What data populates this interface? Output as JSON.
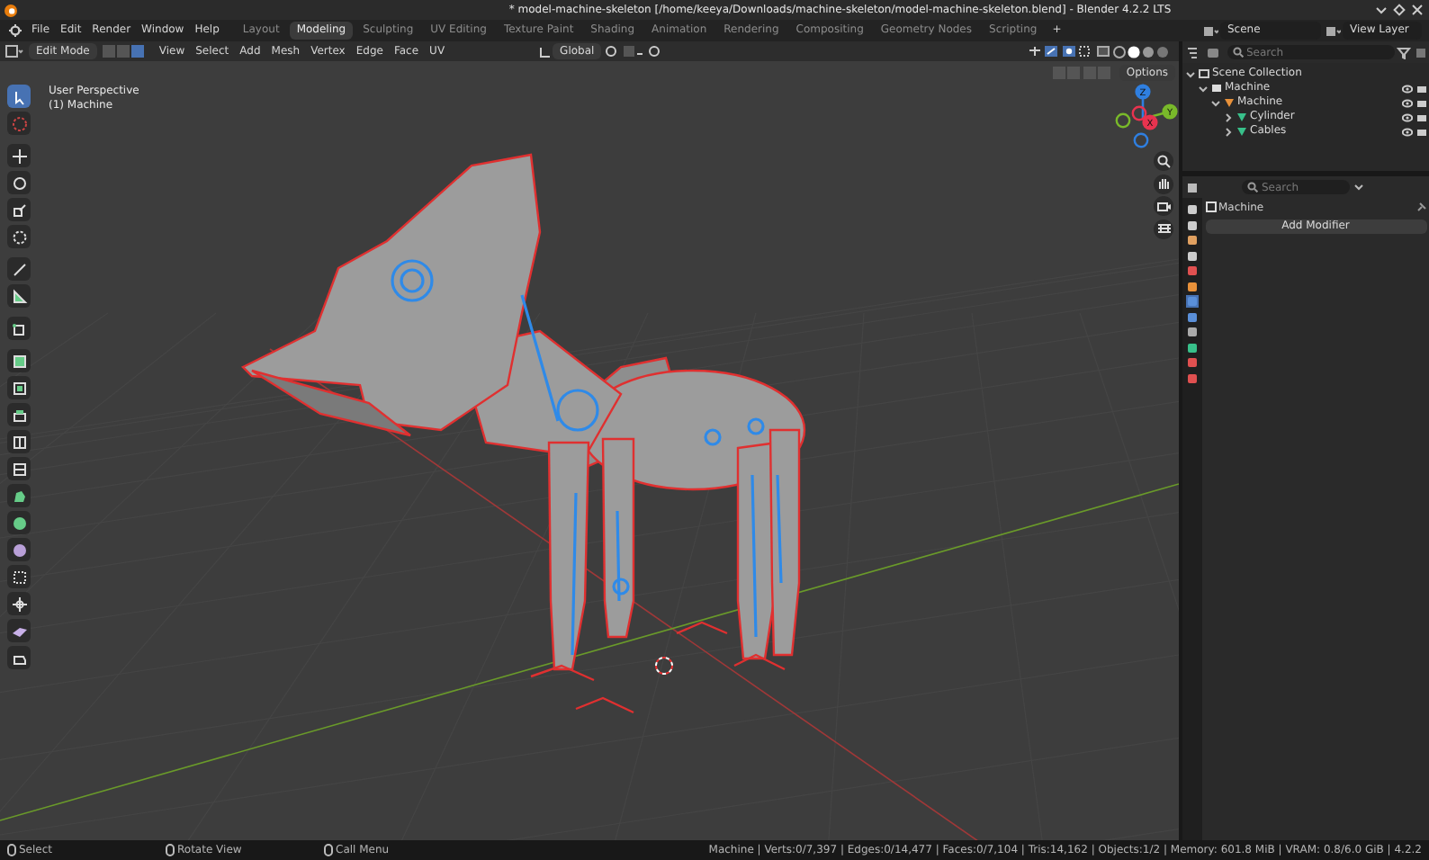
{
  "window": {
    "title": "* model-machine-skeleton [/home/keeya/Downloads/machine-skeleton/model-machine-skeleton.blend] - Blender 4.2.2 LTS"
  },
  "menu": [
    "File",
    "Edit",
    "Render",
    "Window",
    "Help"
  ],
  "workspaces": [
    {
      "label": "Layout",
      "selected": false
    },
    {
      "label": "Modeling",
      "selected": true
    },
    {
      "label": "Sculpting",
      "selected": false
    },
    {
      "label": "UV Editing",
      "selected": false
    },
    {
      "label": "Texture Paint",
      "selected": false
    },
    {
      "label": "Shading",
      "selected": false
    },
    {
      "label": "Animation",
      "selected": false
    },
    {
      "label": "Rendering",
      "selected": false
    },
    {
      "label": "Compositing",
      "selected": false
    },
    {
      "label": "Geometry Nodes",
      "selected": false
    },
    {
      "label": "Scripting",
      "selected": false
    }
  ],
  "add_workspace": "+",
  "scene": "Scene",
  "view_layer": "View Layer",
  "viewport_header": {
    "mode": "Edit Mode",
    "select_modes": [
      {
        "selected": false
      },
      {
        "selected": false
      },
      {
        "selected": true
      }
    ],
    "menus": [
      "View",
      "Select",
      "Add",
      "Mesh",
      "Vertex",
      "Edge",
      "Face",
      "UV"
    ],
    "orientation": "Global",
    "options": "Options"
  },
  "viewport": {
    "overlay": [
      "User Perspective",
      "(1) Machine"
    ],
    "gizmo": [
      {
        "label": "Z",
        "color": "#2f7fe0"
      },
      {
        "label": "Y",
        "color": "#79b92a"
      },
      {
        "label": "X",
        "color": "#e8334f"
      }
    ]
  },
  "toolbar": [
    {
      "selected": true
    },
    {
      "selected": false
    },
    {
      "selected": false
    },
    {
      "selected": false
    },
    {
      "selected": false
    },
    {
      "selected": false
    },
    {
      "selected": false
    },
    {
      "selected": false
    },
    {
      "selected": false
    },
    {
      "selected": false
    },
    {
      "selected": false
    },
    {
      "selected": false
    },
    {
      "selected": false
    },
    {
      "selected": false
    },
    {
      "selected": false
    },
    {
      "selected": false
    },
    {
      "selected": false
    },
    {
      "selected": false
    },
    {
      "selected": false
    },
    {
      "selected": false
    },
    {
      "selected": false
    }
  ],
  "outliner": {
    "search": {
      "placeholder": "Search"
    },
    "tree": [
      {
        "label": "Scene Collection",
        "kind": "scene",
        "expanded": true,
        "children": [
          {
            "label": "Machine",
            "kind": "collection",
            "expanded": true,
            "children": [
              {
                "label": "Machine",
                "kind": "object",
                "expanded": true,
                "children": [
                  {
                    "label": "Cylinder",
                    "kind": "mesh",
                    "expanded": false
                  },
                  {
                    "label": "Cables",
                    "kind": "mesh",
                    "expanded": false
                  }
                ]
              }
            ]
          }
        ]
      }
    ]
  },
  "properties": {
    "search": {
      "placeholder": "Search"
    },
    "object": "Machine",
    "add_modifier": "Add Modifier"
  },
  "status_bar": {
    "hints": [
      "Select",
      "Rotate View",
      "Call Menu"
    ],
    "stats": "Machine | Verts:0/7,397 | Edges:0/14,477 | Faces:0/7,104 | Tris:14,162 | Objects:1/2 | Memory: 601.8 MiB | VRAM: 0.8/6.0 GiB | 4.2.2"
  }
}
